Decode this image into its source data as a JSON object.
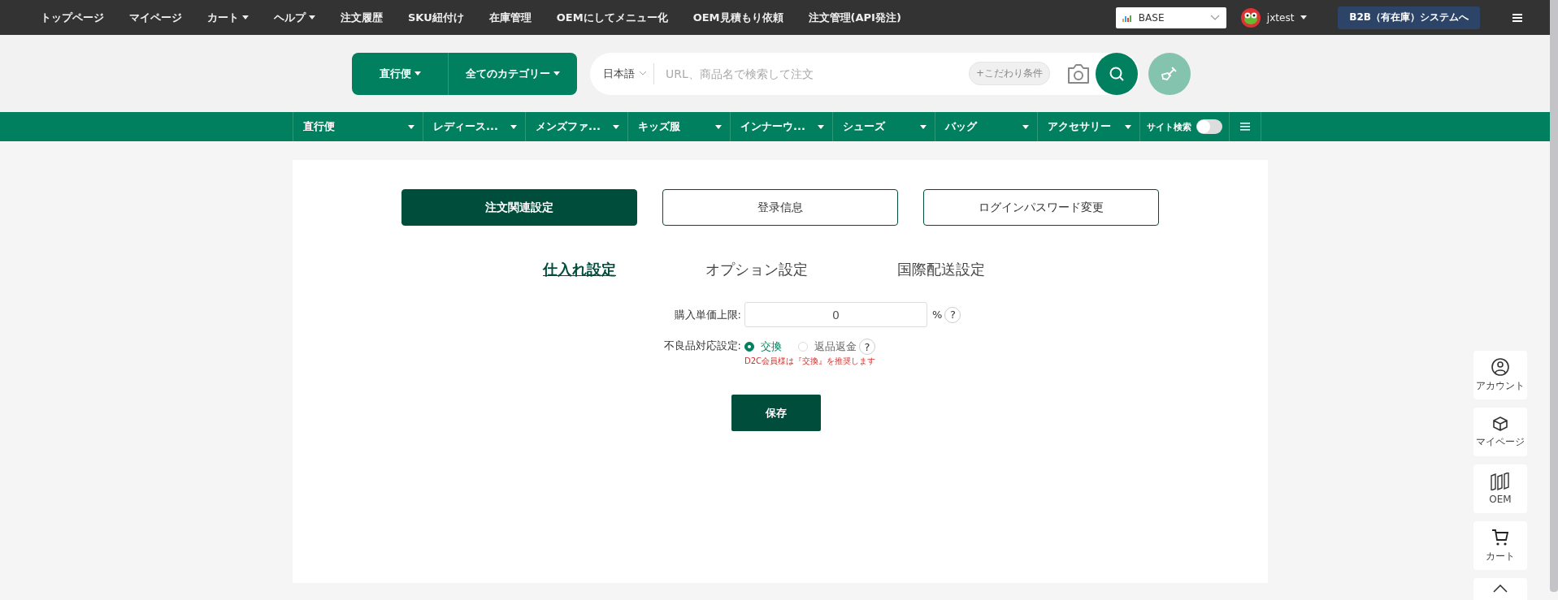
{
  "top_nav": {
    "items": [
      {
        "label": "トップページ",
        "caret": false
      },
      {
        "label": "マイページ",
        "caret": false
      },
      {
        "label": "カート",
        "caret": true
      },
      {
        "label": "ヘルプ",
        "caret": true
      },
      {
        "label": "注文履歴",
        "caret": false
      },
      {
        "label": "SKU紐付け",
        "caret": false
      },
      {
        "label": "在庫管理",
        "caret": false
      },
      {
        "label": "OEMにしてメニュー化",
        "caret": false
      },
      {
        "label": "OEM見積もり依頼",
        "caret": false
      },
      {
        "label": "注文管理(API発注)",
        "caret": false
      }
    ],
    "shop_select": "BASE",
    "user": "jxtest",
    "system_button": "B2B（有在庫）システムへ"
  },
  "search": {
    "mode": "直行便",
    "category": "全てのカテゴリー",
    "language": "日本語",
    "placeholder": "URL、商品名で検索して注文",
    "filter_chip": "+こだわり条件"
  },
  "category_bar": {
    "items": [
      {
        "label": "直行便"
      },
      {
        "label": "レディース..."
      },
      {
        "label": "メンズファ..."
      },
      {
        "label": "キッズ服"
      },
      {
        "label": "インナーウ..."
      },
      {
        "label": "シューズ"
      },
      {
        "label": "バッグ"
      },
      {
        "label": "アクセサリー"
      }
    ],
    "site_search": {
      "label": "サイト検索",
      "on": false
    }
  },
  "settings_tabs": [
    {
      "label": "注文関連設定",
      "selected": true
    },
    {
      "label": "登录信息",
      "selected": false
    },
    {
      "label": "ログインパスワード変更",
      "selected": false
    }
  ],
  "sub_tabs": [
    {
      "label": "仕入れ設定",
      "selected": true
    },
    {
      "label": "オプション設定",
      "selected": false
    },
    {
      "label": "国際配送設定",
      "selected": false
    }
  ],
  "form": {
    "price_limit": {
      "label": "購入単価上限:",
      "value": "0",
      "unit": "%",
      "help": "?"
    },
    "defect": {
      "label": "不良品対応設定:",
      "options": [
        {
          "label": "交換",
          "selected": true
        },
        {
          "label": "返品返金",
          "selected": false
        }
      ],
      "note": "D2C会員様は『交換』を推奨します",
      "help": "?"
    }
  },
  "save_button": "保存",
  "side_dock": [
    {
      "kind": "account",
      "label": "アカウント"
    },
    {
      "kind": "box",
      "label": "マイページ"
    },
    {
      "kind": "oem",
      "label": "OEM"
    },
    {
      "kind": "cart",
      "label": "カート"
    },
    {
      "kind": "top"
    }
  ]
}
